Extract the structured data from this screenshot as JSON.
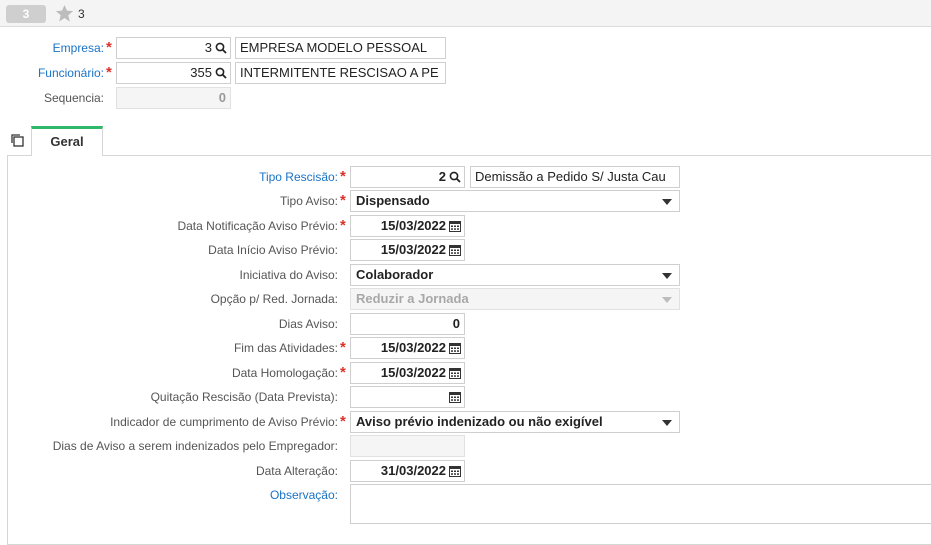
{
  "topbar": {
    "record_number": "3",
    "favorites_count": "3"
  },
  "header": {
    "empresa": {
      "label": "Empresa:",
      "value": "3",
      "description": "EMPRESA MODELO PESSOAL"
    },
    "funcionario": {
      "label": "Funcionário:",
      "value": "355",
      "description": "INTERMITENTE RESCISAO A PE"
    },
    "sequencia": {
      "label": "Sequencia:",
      "value": "0"
    }
  },
  "tabs": [
    {
      "label": "Geral",
      "active": true
    }
  ],
  "form": {
    "tipo_rescisao": {
      "label": "Tipo Rescisão:",
      "value": "2",
      "description": "Demissão a Pedido S/ Justa Cau"
    },
    "tipo_aviso": {
      "label": "Tipo Aviso:",
      "value": "Dispensado"
    },
    "data_notificacao": {
      "label": "Data Notificação Aviso Prévio:",
      "value": "15/03/2022"
    },
    "data_inicio": {
      "label": "Data Início Aviso Prévio:",
      "value": "15/03/2022"
    },
    "iniciativa": {
      "label": "Iniciativa do Aviso:",
      "value": "Colaborador"
    },
    "opcao_red": {
      "label": "Opção p/ Red. Jornada:",
      "value": "Reduzir a Jornada"
    },
    "dias_aviso": {
      "label": "Dias Aviso:",
      "value": "0"
    },
    "fim_atividades": {
      "label": "Fim das Atividades:",
      "value": "15/03/2022"
    },
    "data_homologacao": {
      "label": "Data Homologação:",
      "value": "15/03/2022"
    },
    "quitacao": {
      "label": "Quitação Rescisão (Data Prevista):",
      "value": ""
    },
    "indicador": {
      "label": "Indicador de cumprimento de Aviso Prévio:",
      "value": "Aviso prévio indenizado ou não exigível"
    },
    "dias_indenizados": {
      "label": "Dias de Aviso a serem indenizados pelo Empregador:",
      "value": ""
    },
    "data_alteracao": {
      "label": "Data Alteração:",
      "value": "31/03/2022"
    },
    "observacao": {
      "label": "Observação:",
      "value": ""
    }
  },
  "colors": {
    "link": "#1a73c6",
    "required": "#d9312b",
    "tab_accent": "#2fb86a"
  },
  "icons": [
    "star-icon",
    "search-icon",
    "calendar-icon",
    "dropdown-caret-icon",
    "copy-icon"
  ]
}
